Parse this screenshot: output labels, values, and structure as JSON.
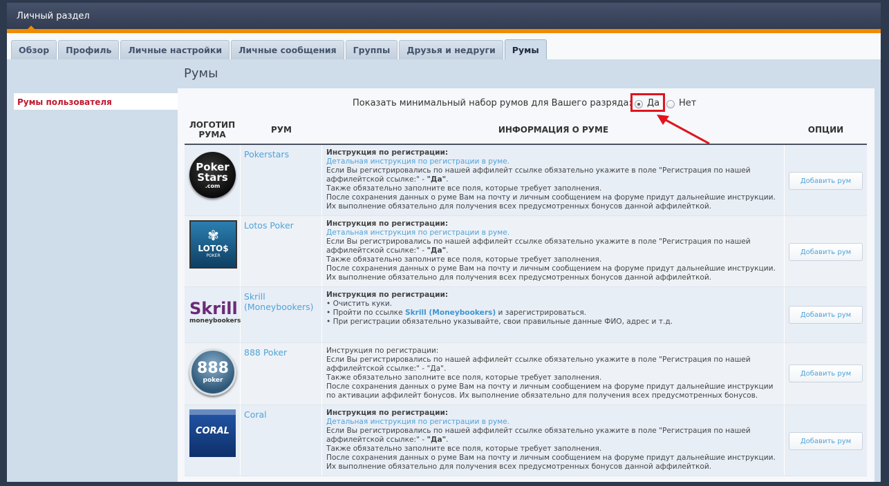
{
  "window": {
    "title": "Личный раздел"
  },
  "tabs": [
    {
      "label": "Обзор"
    },
    {
      "label": "Профиль"
    },
    {
      "label": "Личные настройки"
    },
    {
      "label": "Личные сообщения"
    },
    {
      "label": "Группы"
    },
    {
      "label": "Друзья и недруги"
    },
    {
      "label": "Румы"
    }
  ],
  "active_tab": "Румы",
  "page_title": "Румы",
  "sidebar": {
    "items": [
      {
        "label": "Румы пользователя"
      }
    ]
  },
  "option": {
    "label": "Показать минимальный набор румов для Вашего разряда:",
    "yes_label": "Да",
    "no_label": "Нет",
    "selected": "Да"
  },
  "table": {
    "headers": {
      "logo": "ЛОГОТИП РУМА",
      "room": "РУМ",
      "info": "ИНФОРМАЦИЯ О РУМЕ",
      "options": "ОПЦИИ"
    },
    "rows": [
      {
        "name": "Pokerstars",
        "logo_text": "Poker Stars .com",
        "info_title": "Инструкция по регистрации:",
        "info_link": "Детальная инструкция по регистрации в руме.",
        "info_line1": "Если Вы регистрировались по нашей аффилейт ссылке обязательно укажите в поле \"Регистрация по нашей",
        "info_line2_pre": "аффилейтской ссылке:\" - ",
        "info_line2_bold": "\"Да\"",
        "info_line3": "Также обязательно заполните все поля, которые требует заполнения.",
        "info_line4": "После сохранения данных о руме Вам на почту и личным сообщением на форуме придут дальнейшие инструкции.",
        "info_line5": "Их выполнение обязательно для получения всех предусмотренных бонусов данной аффилейткой.",
        "button": "Добавить рум"
      },
      {
        "name": "Lotos Poker",
        "logo_text": "LOTO$ POKER",
        "info_title": "Инструкция по регистрации:",
        "info_link": "Детальная инструкция по регистрации в руме.",
        "info_line1": "Если Вы регистрировались по нашей аффилейт ссылке обязательно укажите в поле \"Регистрация по нашей",
        "info_line2_pre": "аффилейтской ссылке:\" - ",
        "info_line2_bold": "\"Да\"",
        "info_line3": "Также обязательно заполните все поля, которые требует заполнения.",
        "info_line4": "После сохранения данных о руме Вам на почту и личным сообщением на форуме придут дальнейшие инструкции.",
        "info_line5": "Их выполнение обязательно для получения всех предусмотренных бонусов данной аффилейткой.",
        "button": "Добавить рум"
      },
      {
        "name": "Skrill (Moneybookers)",
        "logo_text": "Skrill moneybookers",
        "info_title": "Инструкция по регистрации:",
        "bullet1": "Очистить куки.",
        "bullet2_pre": "Пройти по ссылке ",
        "bullet2_link": "Skrill (Moneybookers)",
        "bullet2_post": " и зарегистрироваться.",
        "bullet3": "При регистрации обязательно указывайте, свои правильные данные ФИО, адрес и т.д.",
        "button": "Добавить рум"
      },
      {
        "name": "888 Poker",
        "logo_text": "888 poker",
        "info_title": "Инструкция по регистрации:",
        "info_line1": "Если Вы регистрировались по нашей аффилейт ссылке обязательно укажите в поле \"Регистрация по нашей",
        "info_line2": "аффилейтской ссылке:\" - \"Да\".",
        "info_line3": "Также обязательно заполните все поля, которые требует заполнения.",
        "info_line4": "После сохранения данных о руме Вам на почту и личным сообщением на форуме придут дальнейшие инструкции",
        "info_line5": "по активации аффилейт бонусов. Их выполнение обязательно для получения всех предусмотренных бонусов.",
        "button": "Добавить рум"
      },
      {
        "name": "Coral",
        "logo_text": "CORAL",
        "info_title": "Инструкция по регистрации:",
        "info_link": "Детальная инструкция по регистрации в руме.",
        "info_line1": "Если Вы регистрировались по нашей аффилейт ссылке обязательно укажите в поле \"Регистрация по нашей",
        "info_line2_pre": "аффилейтской ссылке:\" - ",
        "info_line2_bold": "\"Да\"",
        "info_line3": "Также обязательно заполните все поля, которые требует заполнения.",
        "info_line4": "После сохранения данных о руме Вам на почту и личным сообщением на форуме придут дальнейшие инструкции.",
        "info_line5": "Их выполнение обязательно для получения всех предусмотренных бонусов данной аффилейткой.",
        "button": "Добавить рум"
      }
    ]
  },
  "colors": {
    "accent_orange": "#f08a00",
    "link_blue": "#4fa3d8",
    "sidebar_active": "#c0182d",
    "highlight_red": "#e0141e"
  }
}
